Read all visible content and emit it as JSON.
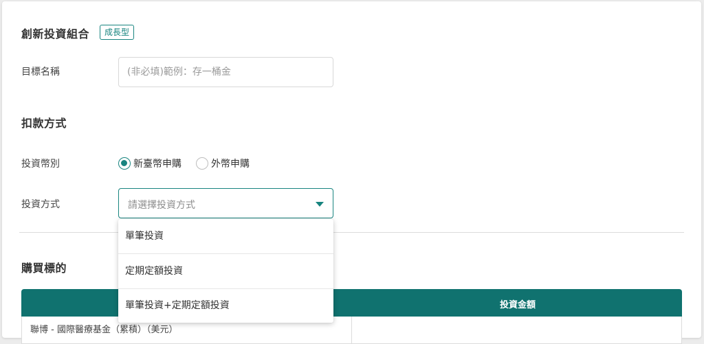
{
  "goal_section": {
    "title": "創新投資組合",
    "badge": "成長型",
    "name_label": "目標名稱",
    "name_placeholder": "(非必填)範例：存一桶金",
    "name_value": ""
  },
  "payment_section": {
    "title": "扣款方式",
    "currency_label": "投資幣別",
    "currency_options": [
      {
        "label": "新臺幣申購",
        "checked": true
      },
      {
        "label": "外幣申購",
        "checked": false
      }
    ],
    "method_label": "投資方式",
    "method_placeholder": "請選擇投資方式",
    "method_options": [
      "單筆投資",
      "定期定額投資",
      "單筆投資+定期定額投資"
    ]
  },
  "purchase_section": {
    "title": "購買標的",
    "amount_header": "投資金額",
    "fund_row_text": "聯博 - 國際醫療基金（累積）（美元）"
  },
  "colors": {
    "accent": "#17847f",
    "table_header": "#10726f"
  }
}
